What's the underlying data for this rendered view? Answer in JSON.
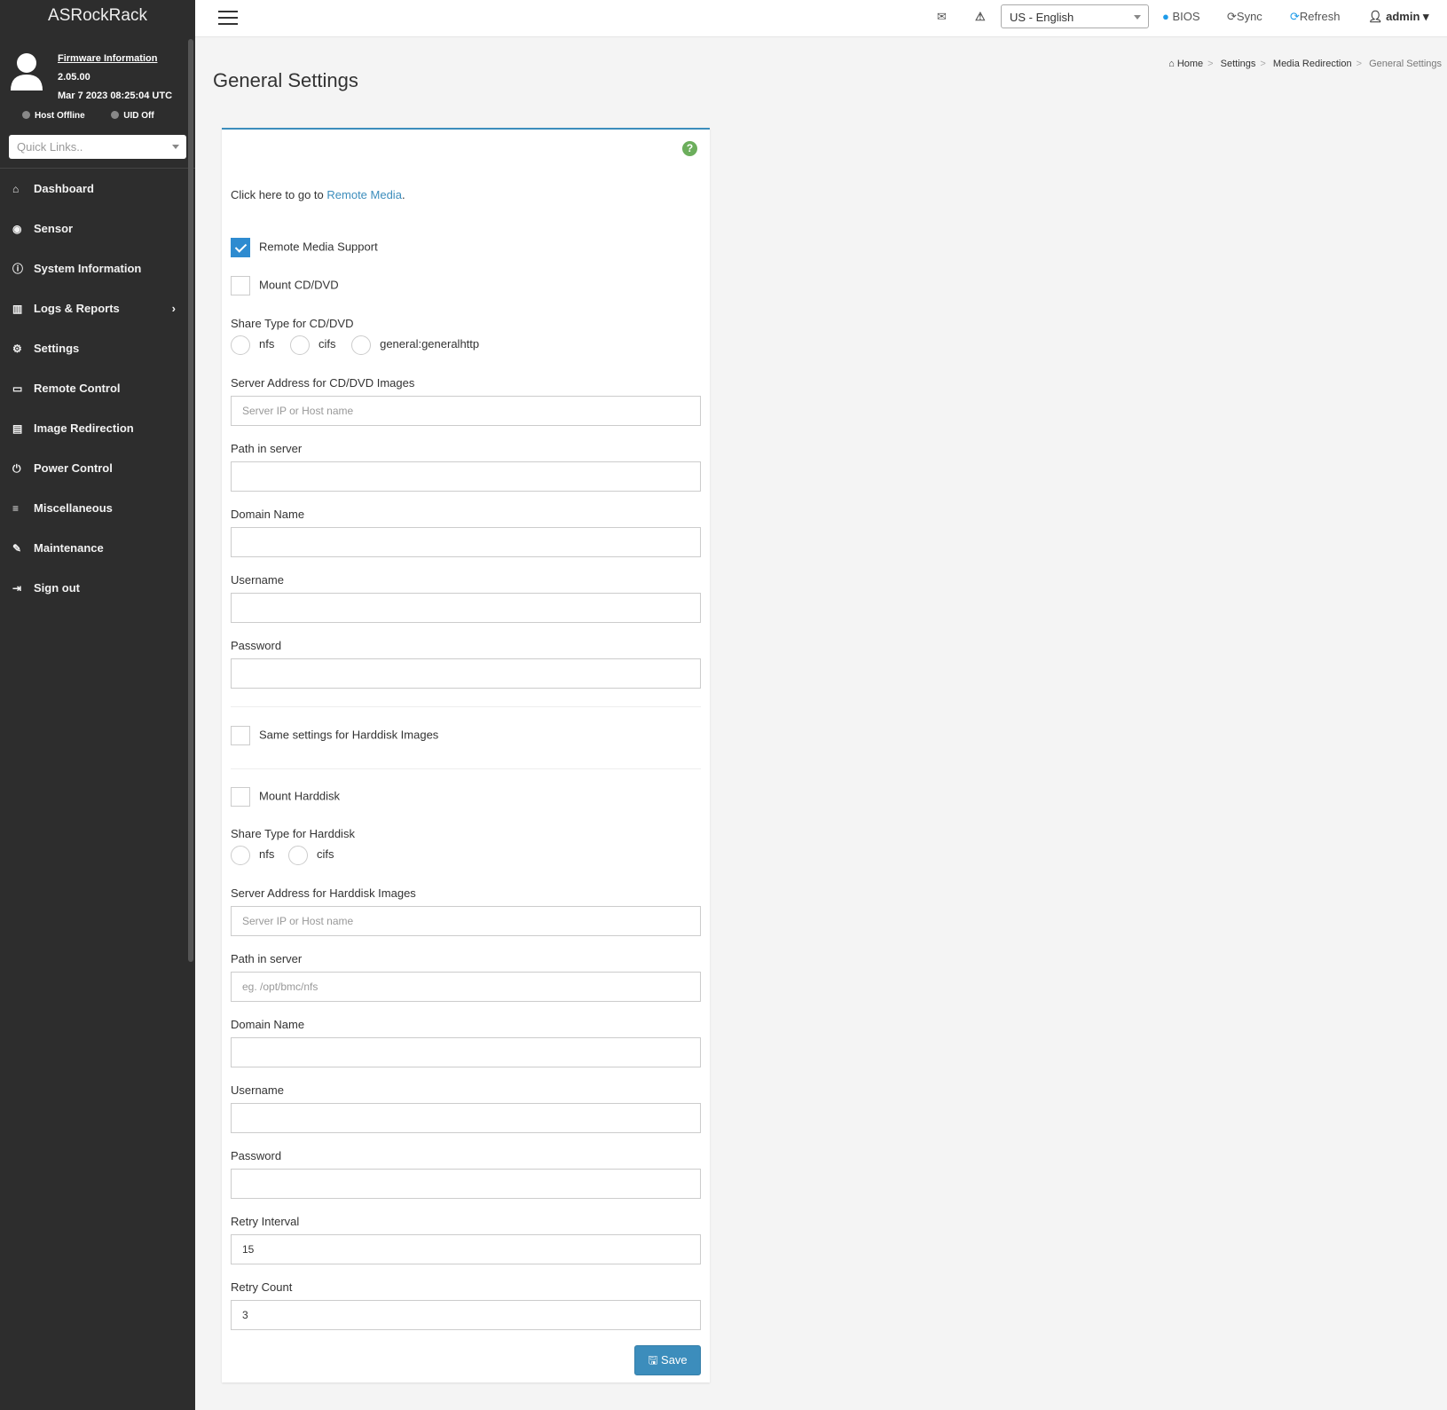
{
  "sidebar": {
    "brand": "ASRockRack",
    "firmware_link": "Firmware Information",
    "version": "2.05.00",
    "build_date": "Mar 7 2023 08:25:04 UTC",
    "host_status": "Host Offline",
    "uid_status": "UID Off",
    "quick_links_placeholder": "Quick Links..",
    "items": [
      {
        "label": "Dashboard",
        "icon": "home-icon",
        "glyph": "⌂"
      },
      {
        "label": "Sensor",
        "icon": "gauge-icon",
        "glyph": "◉"
      },
      {
        "label": "System Information",
        "icon": "info-icon",
        "glyph": "ⓘ"
      },
      {
        "label": "Logs & Reports",
        "icon": "bar-chart-icon",
        "glyph": "▥"
      },
      {
        "label": "Settings",
        "icon": "gear-icon",
        "glyph": "⚙"
      },
      {
        "label": "Remote Control",
        "icon": "monitor-icon",
        "glyph": "▭"
      },
      {
        "label": "Image Redirection",
        "icon": "drive-icon",
        "glyph": "▤"
      },
      {
        "label": "Power Control",
        "icon": "power-icon",
        "glyph": "⏻"
      },
      {
        "label": "Miscellaneous",
        "icon": "list-icon",
        "glyph": "≡"
      },
      {
        "label": "Maintenance",
        "icon": "wrench-icon",
        "glyph": "✎"
      },
      {
        "label": "Sign out",
        "icon": "sign-out-icon",
        "glyph": "⇥"
      }
    ]
  },
  "topbar": {
    "language": "US - English",
    "bios": "BIOS",
    "sync": "Sync",
    "refresh": "Refresh",
    "user": "admin"
  },
  "page": {
    "title": "General Settings",
    "breadcrumb": [
      "Home",
      "Settings",
      "Media Redirection",
      "General Settings"
    ]
  },
  "form": {
    "intro": "Click here to go to ",
    "intro_link": "Remote Media",
    "intro_end": ".",
    "remote_media_support": {
      "label": "Remote Media Support",
      "checked": true
    },
    "mount_cd": {
      "label": "Mount CD/DVD",
      "checked": false
    },
    "cd_share_type_label": "Share Type for CD/DVD",
    "cd_share_types": [
      "nfs",
      "cifs",
      "general:generalhttp"
    ],
    "cd_server_label": "Server Address for CD/DVD Images",
    "cd_server_placeholder": "Server IP or Host name",
    "cd_path_label": "Path in server",
    "cd_domain_label": "Domain Name",
    "cd_username_label": "Username",
    "cd_password_label": "Password",
    "same_settings": {
      "label": "Same settings for Harddisk Images",
      "checked": false
    },
    "mount_hd": {
      "label": "Mount Harddisk",
      "checked": false
    },
    "hd_share_type_label": "Share Type for Harddisk",
    "hd_share_types": [
      "nfs",
      "cifs"
    ],
    "hd_server_label": "Server Address for Harddisk Images",
    "hd_server_placeholder": "Server IP or Host name",
    "hd_path_label": "Path in server",
    "hd_path_placeholder": "eg. /opt/bmc/nfs",
    "hd_domain_label": "Domain Name",
    "hd_username_label": "Username",
    "hd_password_label": "Password",
    "retry_interval_label": "Retry Interval",
    "retry_interval": "15",
    "retry_count_label": "Retry Count",
    "retry_count": "3",
    "save_label": "Save"
  }
}
